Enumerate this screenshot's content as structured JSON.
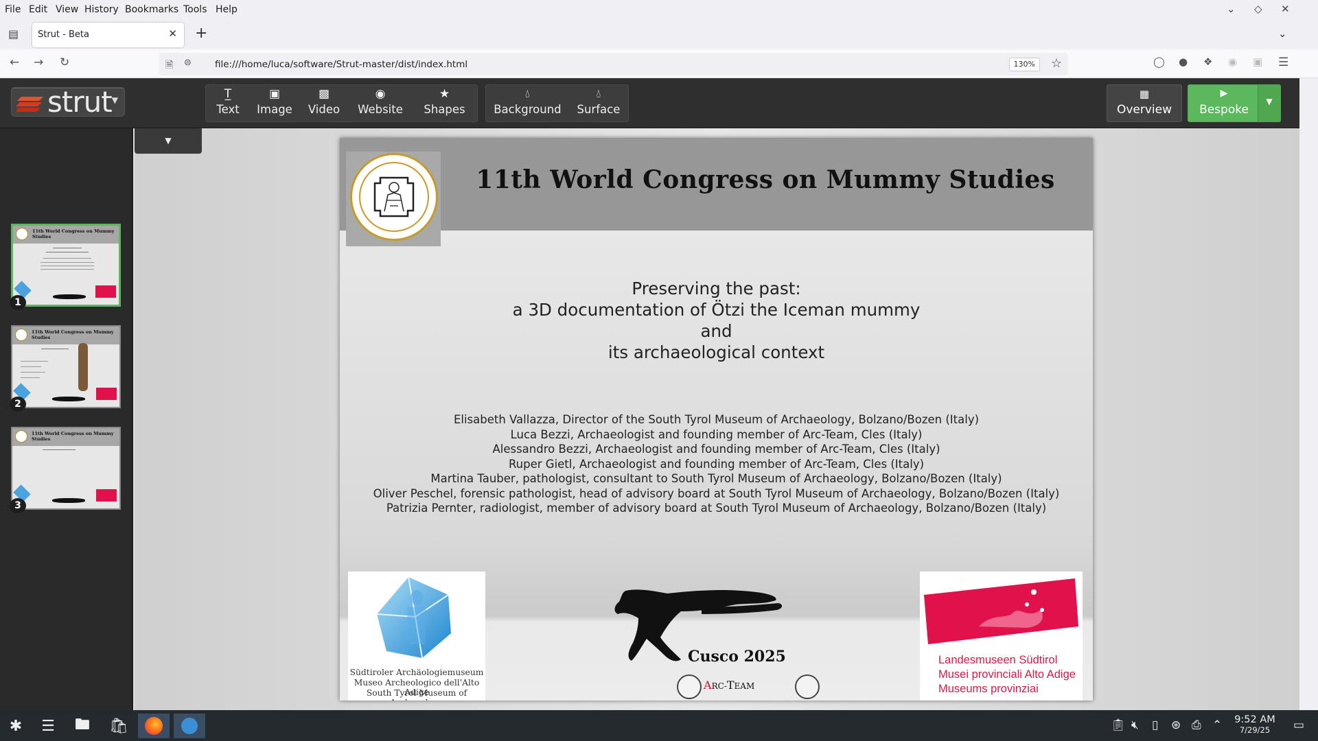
{
  "menubar": {
    "items": [
      "File",
      "Edit",
      "View",
      "History",
      "Bookmarks",
      "Tools",
      "Help"
    ]
  },
  "tab": {
    "title": "Strut - Beta"
  },
  "navbar": {
    "url": "file:///home/luca/software/Strut-master/dist/index.html",
    "zoom": "130%"
  },
  "app": {
    "logo_text": "strut",
    "insert_buttons": [
      {
        "label": "Text",
        "icon": "text-icon"
      },
      {
        "label": "Image",
        "icon": "image-icon"
      },
      {
        "label": "Video",
        "icon": "video-icon"
      },
      {
        "label": "Website",
        "icon": "globe-icon"
      },
      {
        "label": "Shapes",
        "icon": "star-icon"
      }
    ],
    "style_buttons": [
      {
        "label": "Background",
        "icon": "drop-icon"
      },
      {
        "label": "Surface",
        "icon": "drop-icon"
      }
    ],
    "overview_label": "Overview",
    "bespoke_label": "Bespoke",
    "slides": [
      {
        "number": "1",
        "title": "11th World Congress on Mummy Studies",
        "selected": true
      },
      {
        "number": "2",
        "title": "11th World Congress on Mummy Studies",
        "selected": false
      },
      {
        "number": "3",
        "title": "11th World Congress on Mummy Studies",
        "selected": false
      }
    ],
    "thumb_small": {
      "cusco": "Cusco 2025"
    }
  },
  "slide": {
    "title": "11th World Congress on Mummy Studies",
    "subtitle": [
      "Preserving the past:",
      "a 3D documentation of Ötzi the Iceman mummy",
      "and",
      "its archaeological context"
    ],
    "authors": [
      "Elisabeth Vallazza, Director of the South Tyrol Museum of Archaeology, Bolzano/Bozen (Italy)",
      "Luca Bezzi, Archaeologist and founding member of Arc-Team, Cles (Italy)",
      "Alessandro Bezzi, Archaeologist and founding member of Arc-Team, Cles (Italy)",
      "Ruper Gietl, Archaeologist and founding member of Arc-Team, Cles (Italy)",
      "Martina Tauber, pathologist, consultant to South Tyrol Museum of Archaeology, Bolzano/Bozen (Italy)",
      "Oliver Peschel, forensic pathologist, head of advisory board at South Tyrol Museum of Archaeology, Bolzano/Bozen (Italy)",
      "Patrizia Pernter, radiologist, member of advisory board at South Tyrol Museum of Archaeology, Bolzano/Bozen (Italy)"
    ],
    "museum_left": [
      "Südtiroler Archäologiemuseum",
      "Museo Archeologico dell'Alto Adige",
      "South Tyrol Museum of Archaeology"
    ],
    "museum_right": [
      "Landesmuseen Südtirol",
      "Musei provinciali Alto Adige",
      "Museums provinziai"
    ],
    "cusco": "Cusco 2025",
    "arcteam_a": "A",
    "arcteam_rest": "RC-",
    "arcteam_t": "T",
    "arcteam_rest2": "EAM"
  },
  "clock": {
    "time": "9:52 AM",
    "date": "7/29/25"
  },
  "colors": {
    "accent_green": "#5cb85c",
    "toolbar_dark": "#2f2f2f",
    "brand_red": "#d21b48"
  }
}
